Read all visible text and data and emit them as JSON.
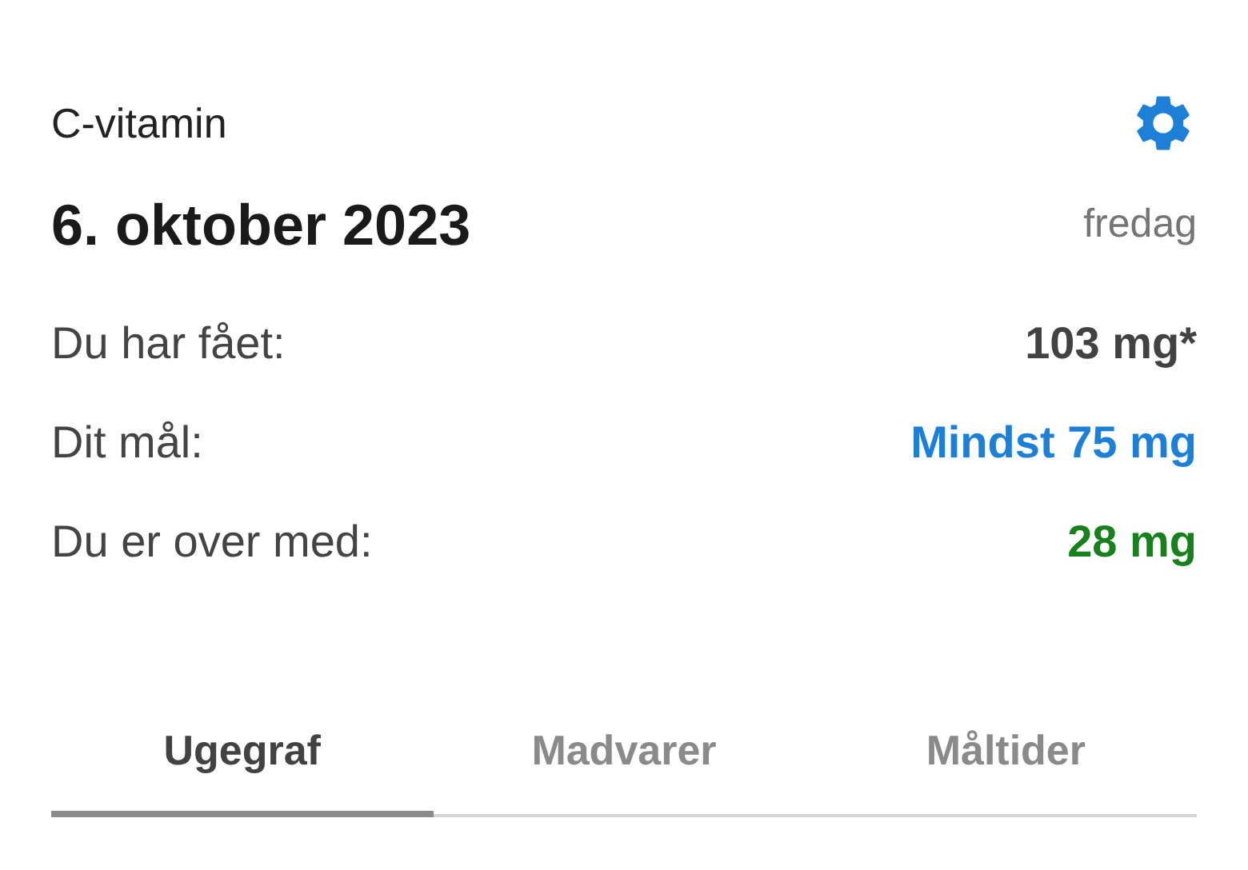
{
  "title": "C-vitamin",
  "date": "6. oktober 2023",
  "weekday": "fredag",
  "rows": [
    {
      "label": "Du har fået:",
      "value": "103 mg*",
      "kind": "intake"
    },
    {
      "label": "Dit mål:",
      "value": "Mindst 75 mg",
      "kind": "goal"
    },
    {
      "label": "Du er over med:",
      "value": "28 mg",
      "kind": "surplus"
    }
  ],
  "tabs": [
    {
      "label": "Ugegraf",
      "selected": true
    },
    {
      "label": "Madvarer",
      "selected": false
    },
    {
      "label": "Måltider",
      "selected": false
    }
  ]
}
